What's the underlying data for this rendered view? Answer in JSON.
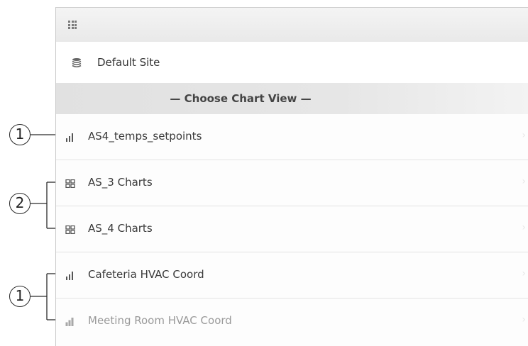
{
  "header": {
    "apps_icon": "grid-icon"
  },
  "site": {
    "icon": "layers-icon",
    "label": "Default Site"
  },
  "chart_view": {
    "label": "— Choose Chart View —"
  },
  "items": [
    {
      "label": "AS4_temps_setpoints",
      "icon": "bar-chart-icon"
    },
    {
      "label": "AS_3 Charts",
      "icon": "dashboard-icon"
    },
    {
      "label": "AS_4 Charts",
      "icon": "dashboard-icon"
    },
    {
      "label": "Cafeteria HVAC Coord",
      "icon": "bar-chart-icon"
    },
    {
      "label": "Meeting Room HVAC Coord",
      "icon": "bar-chart-icon"
    }
  ],
  "callouts": [
    "1",
    "2",
    "1"
  ]
}
